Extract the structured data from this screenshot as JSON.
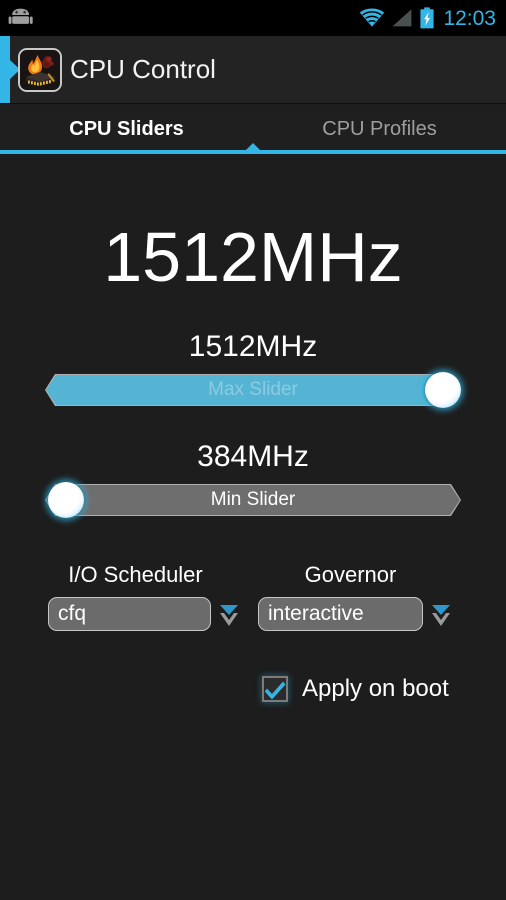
{
  "status_bar": {
    "clock": "12:03",
    "icons": {
      "notification": "android-robot-icon",
      "wifi": "wifi-icon",
      "signal": "cellular-signal-icon",
      "battery": "battery-charging-icon"
    },
    "clock_color": "#33b5e5"
  },
  "action_bar": {
    "title": "CPU Control",
    "app_icon": "cpu-flame-app-icon",
    "up_icon": "up-navigation-chevron-icon"
  },
  "tabs": [
    {
      "label": "CPU Sliders",
      "active": true
    },
    {
      "label": "CPU Profiles",
      "active": false
    }
  ],
  "theme": {
    "accent": "#33b5e5",
    "slider_fill": "#55b4d4",
    "slider_track": "#6e6e6e",
    "background": "#1d1d1d",
    "action_bar": "#232323"
  },
  "main": {
    "current_frequency": "1512MHz",
    "max_slider": {
      "value": "1512MHz",
      "label": "Max Slider",
      "fill_percent": 100
    },
    "min_slider": {
      "value": "384MHz",
      "label": "Min Slider",
      "fill_percent": 0
    },
    "io_scheduler": {
      "label": "I/O Scheduler",
      "value": "cfq",
      "arrow_icon": "chevron-down-icon"
    },
    "governor": {
      "label": "Governor",
      "value": "interactive",
      "arrow_icon": "chevron-down-icon"
    },
    "apply_on_boot": {
      "label": "Apply on boot",
      "checked": true,
      "check_icon": "checkmark-icon"
    }
  }
}
